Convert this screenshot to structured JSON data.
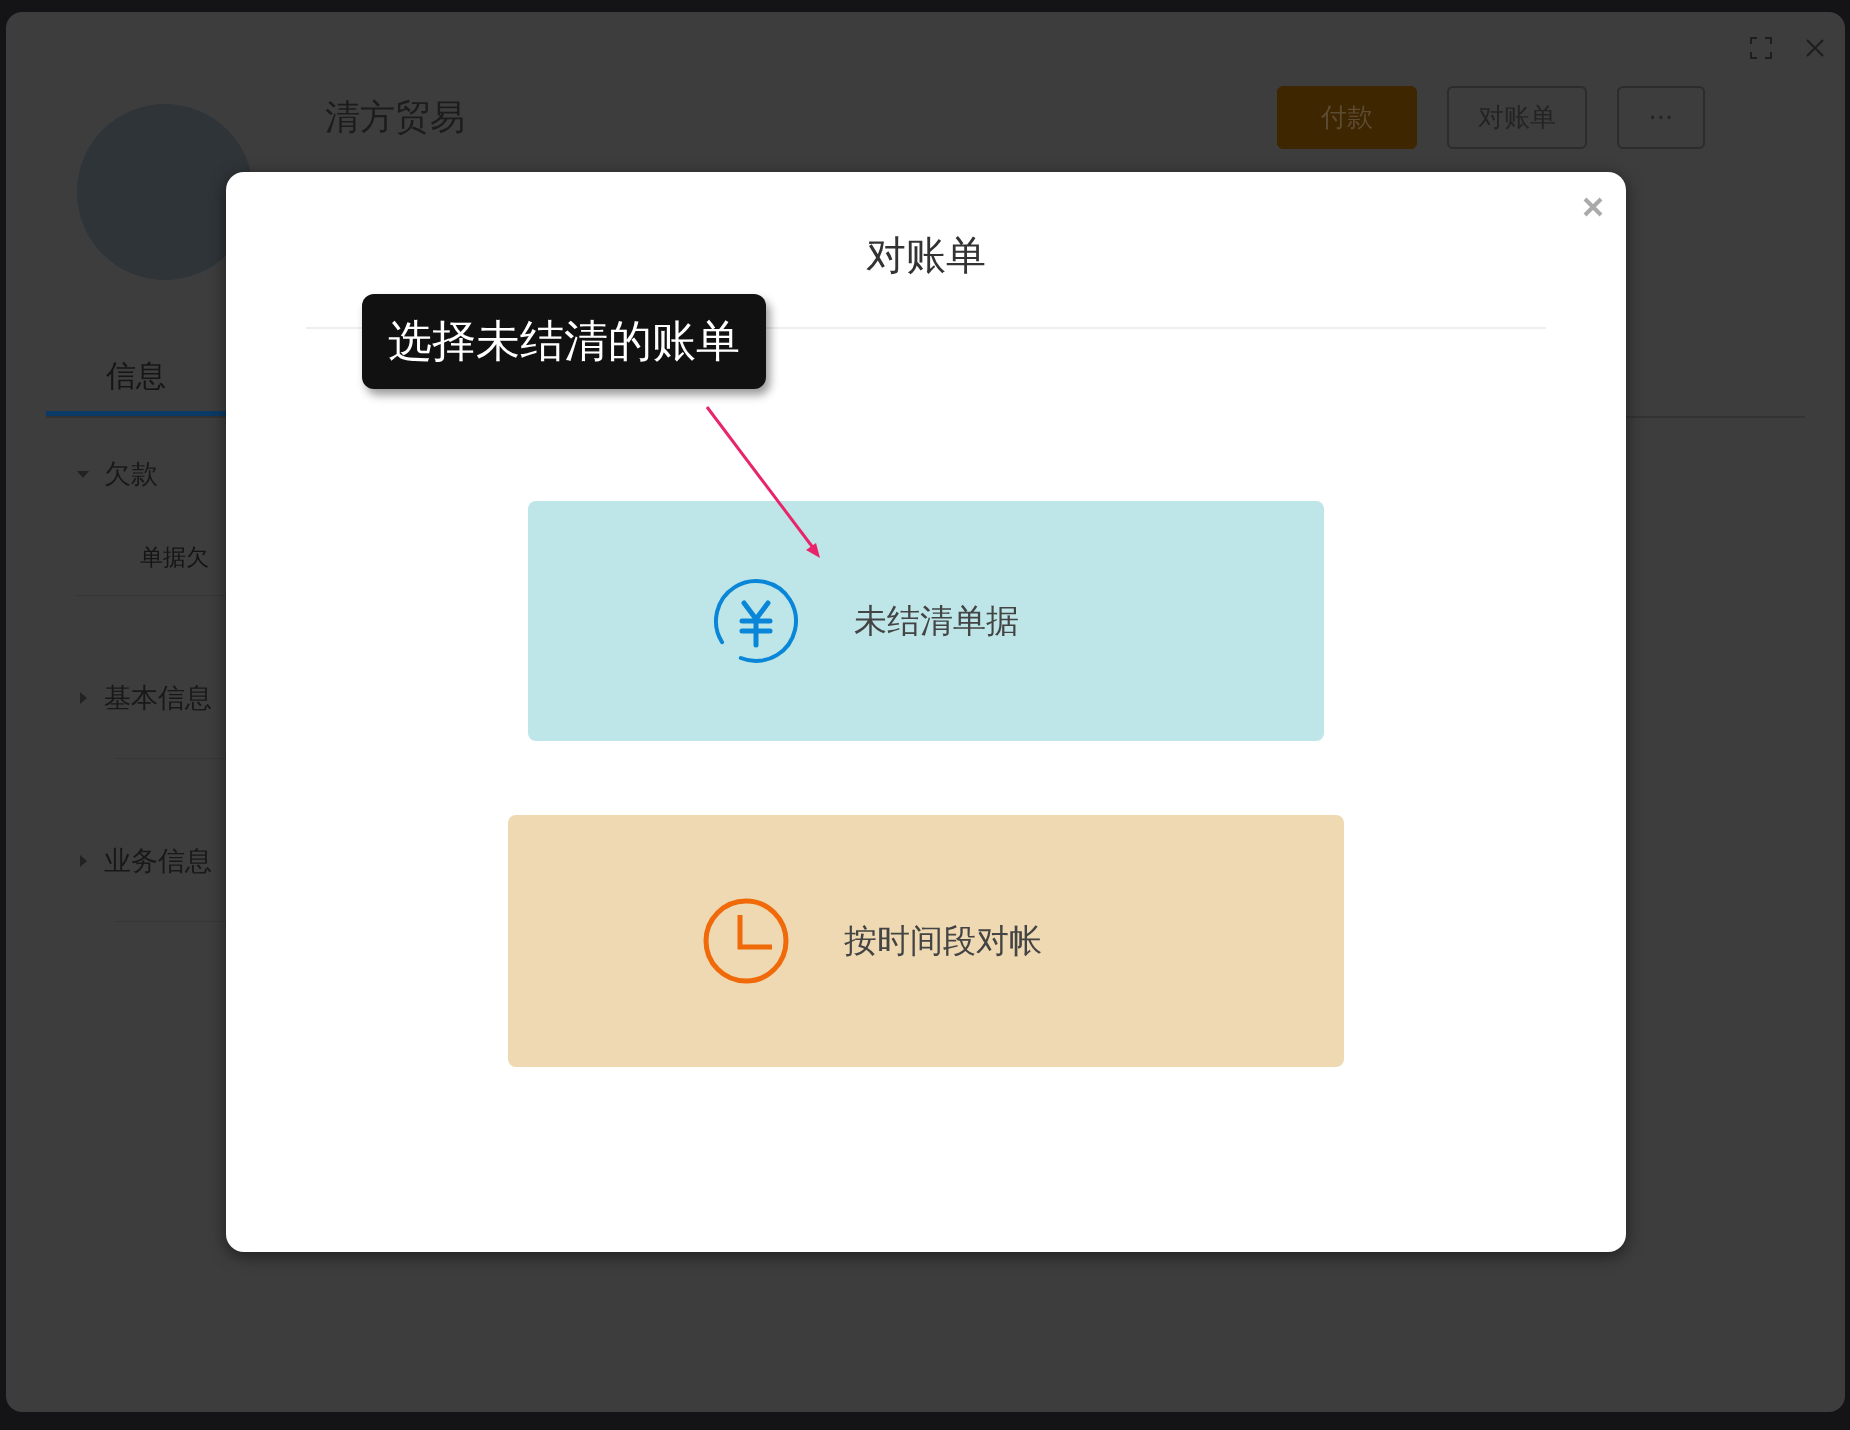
{
  "header": {
    "company": "清方贸易",
    "buttons": [
      {
        "label": "付款",
        "kind": "primary"
      },
      {
        "label": "对账单",
        "kind": "outline"
      },
      {
        "label": "···",
        "kind": "outline"
      }
    ]
  },
  "tabs": [
    {
      "label": "信息",
      "selected": true
    }
  ],
  "sidebar": {
    "sections": [
      {
        "label": "欠款",
        "expanded": true,
        "children": [
          {
            "label": "单据欠"
          }
        ]
      },
      {
        "label": "基本信息",
        "expanded": false
      },
      {
        "label": "业务信息",
        "expanded": false
      }
    ]
  },
  "dialog": {
    "title": "对账单",
    "callout": "选择未结清的账单",
    "options": [
      {
        "kind": "unsettled",
        "label": "未结清单据"
      },
      {
        "kind": "period",
        "label": "按时间段对帐"
      }
    ]
  }
}
